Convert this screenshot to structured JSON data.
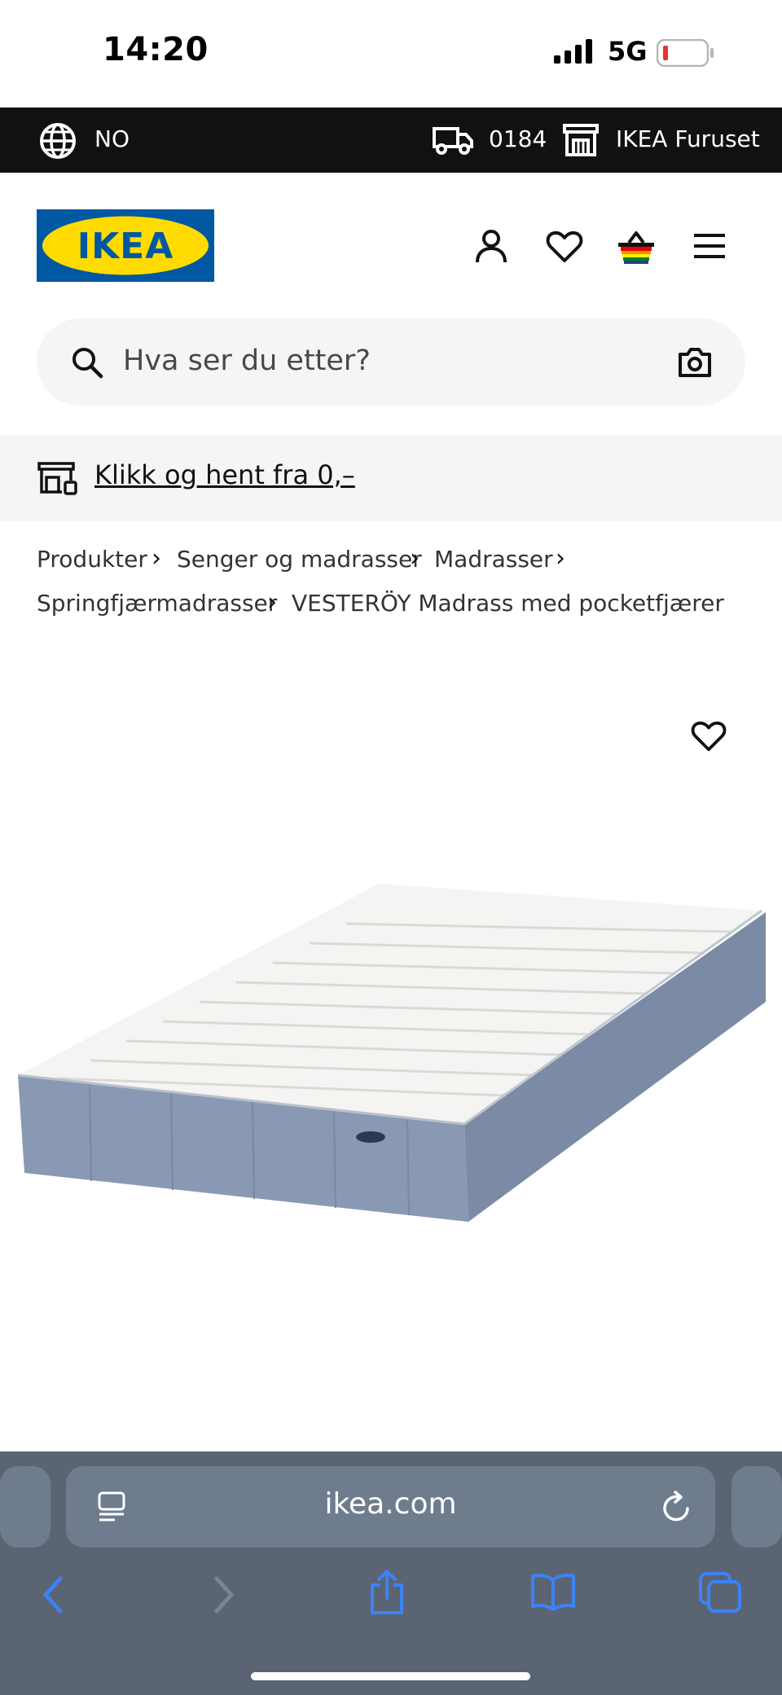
{
  "status_bar": {
    "time": "14:20",
    "network": "5G"
  },
  "top_bar": {
    "language": "NO",
    "postal_code": "0184",
    "store": "IKEA Furuset"
  },
  "header": {
    "logo_text": "IKEA",
    "icons": [
      "user-icon",
      "heart-icon",
      "basket-icon",
      "menu-icon"
    ]
  },
  "search": {
    "placeholder": "Hva ser du etter?"
  },
  "promo": {
    "text": "Klikk og hent fra 0,–"
  },
  "breadcrumb": {
    "items": [
      "Produkter",
      "Senger og madrasser",
      "Madrasser",
      "Springfjærmadrasser",
      "VESTERÖY Madrass med pocketfjærer"
    ]
  },
  "browser": {
    "url": "ikea.com"
  },
  "colors": {
    "ikea_blue": "#0058a3",
    "ikea_yellow": "#ffdb00",
    "top_bar_bg": "#111111",
    "browser_bar_bg": "#5b6473",
    "ios_link_blue": "#3c82f6"
  }
}
